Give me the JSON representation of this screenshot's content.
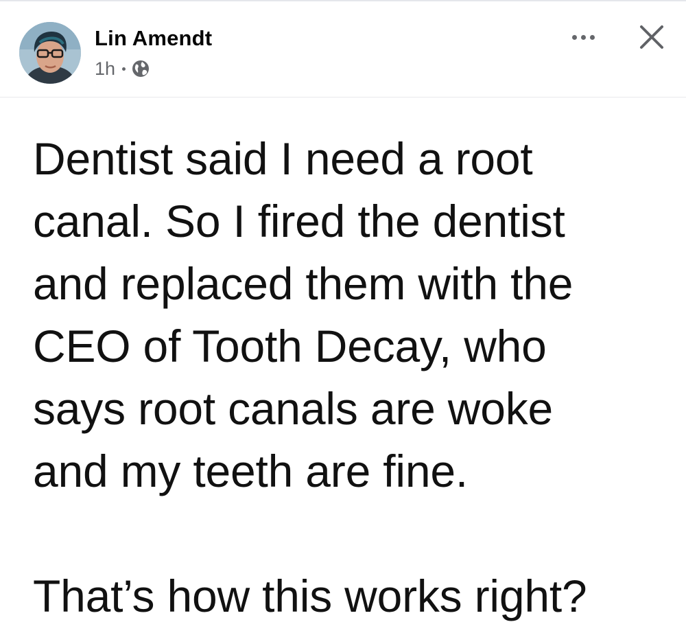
{
  "post": {
    "author": {
      "name": "Lin Amendt",
      "avatar_icon": "profile-photo"
    },
    "meta": {
      "time": "1h",
      "audience_icon": "globe-icon"
    },
    "actions": {
      "more_icon": "more-options-icon",
      "close_icon": "close-icon"
    },
    "body": {
      "paragraph": "Dentist said I need a root\ncanal. So I fired the dentist\nand replaced them with the\nCEO of Tooth Decay, who\nsays root canals are woke\nand my teeth are fine.",
      "closing": "That’s how this works right?"
    }
  },
  "colors": {
    "text": "#050505",
    "secondary_text": "#65676b",
    "divider": "#e4e6eb",
    "background": "#ffffff"
  }
}
